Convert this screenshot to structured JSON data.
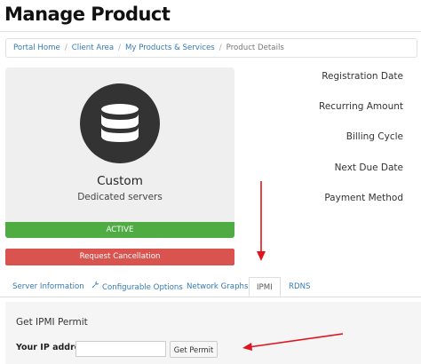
{
  "page": {
    "title": "Manage Product"
  },
  "breadcrumb": {
    "items": [
      "Portal Home",
      "Client Area",
      "My Products & Services"
    ],
    "current": "Product Details"
  },
  "product": {
    "icon": "database-icon",
    "name": "Custom",
    "group": "Dedicated servers",
    "status": "ACTIVE",
    "cancel_label": "Request Cancellation"
  },
  "info_labels": [
    "Registration Date",
    "Recurring Amount",
    "Billing Cycle",
    "Next Due Date",
    "Payment Method"
  ],
  "tabs": [
    {
      "label": "Server Information"
    },
    {
      "label": "Configurable Options",
      "icon": "wrench-icon"
    },
    {
      "label": "Network Graphs"
    },
    {
      "label": "IPMI",
      "active": true
    },
    {
      "label": "RDNS"
    }
  ],
  "ipmi": {
    "heading": "Get IPMI Permit",
    "ip_label": "Your IP address",
    "ip_value": "",
    "button_label": "Get Permit"
  },
  "colors": {
    "status_active": "#4fac43",
    "cancel": "#d9534f",
    "link": "#337ab7",
    "arrow": "#e0141e"
  }
}
